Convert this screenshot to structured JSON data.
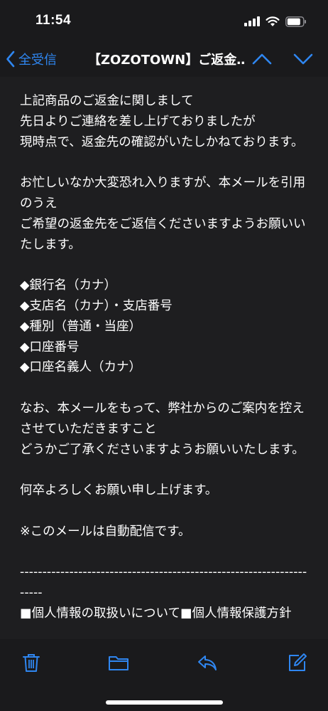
{
  "status": {
    "time": "11:54"
  },
  "nav": {
    "back_label": "全受信",
    "title": "【ZOZOTOWN】ご返金…"
  },
  "email": {
    "body": "上記商品のご返金に関しまして\n先日よりご連絡を差し上げておりましたが\n現時点で、返金先の確認がいたしかねております。\n\nお忙しいなか大変恐れ入りますが、本メールを引用のうえ\nご希望の返金先をご返信くださいますようお願いいたします。\n\n◆銀行名（カナ）\n◆支店名（カナ）・支店番号\n◆種別（普通・当座）\n◆口座番号\n◆口座名義人（カナ）\n\nなお、本メールをもって、弊社からのご案内を控えさせていただきますこと\nどうかご了承くださいますようお願いいたします。\n\n何卒よろしくお願い申し上げます。\n\n※このメールは自動配信です。\n\n---------------------------------------------------------------------\n■個人情報の取扱いについて■個人情報保護方針"
  },
  "icons": {
    "accent": "#2f86f0",
    "toolbar": [
      "trash-icon",
      "folder-icon",
      "reply-icon",
      "compose-icon"
    ]
  }
}
